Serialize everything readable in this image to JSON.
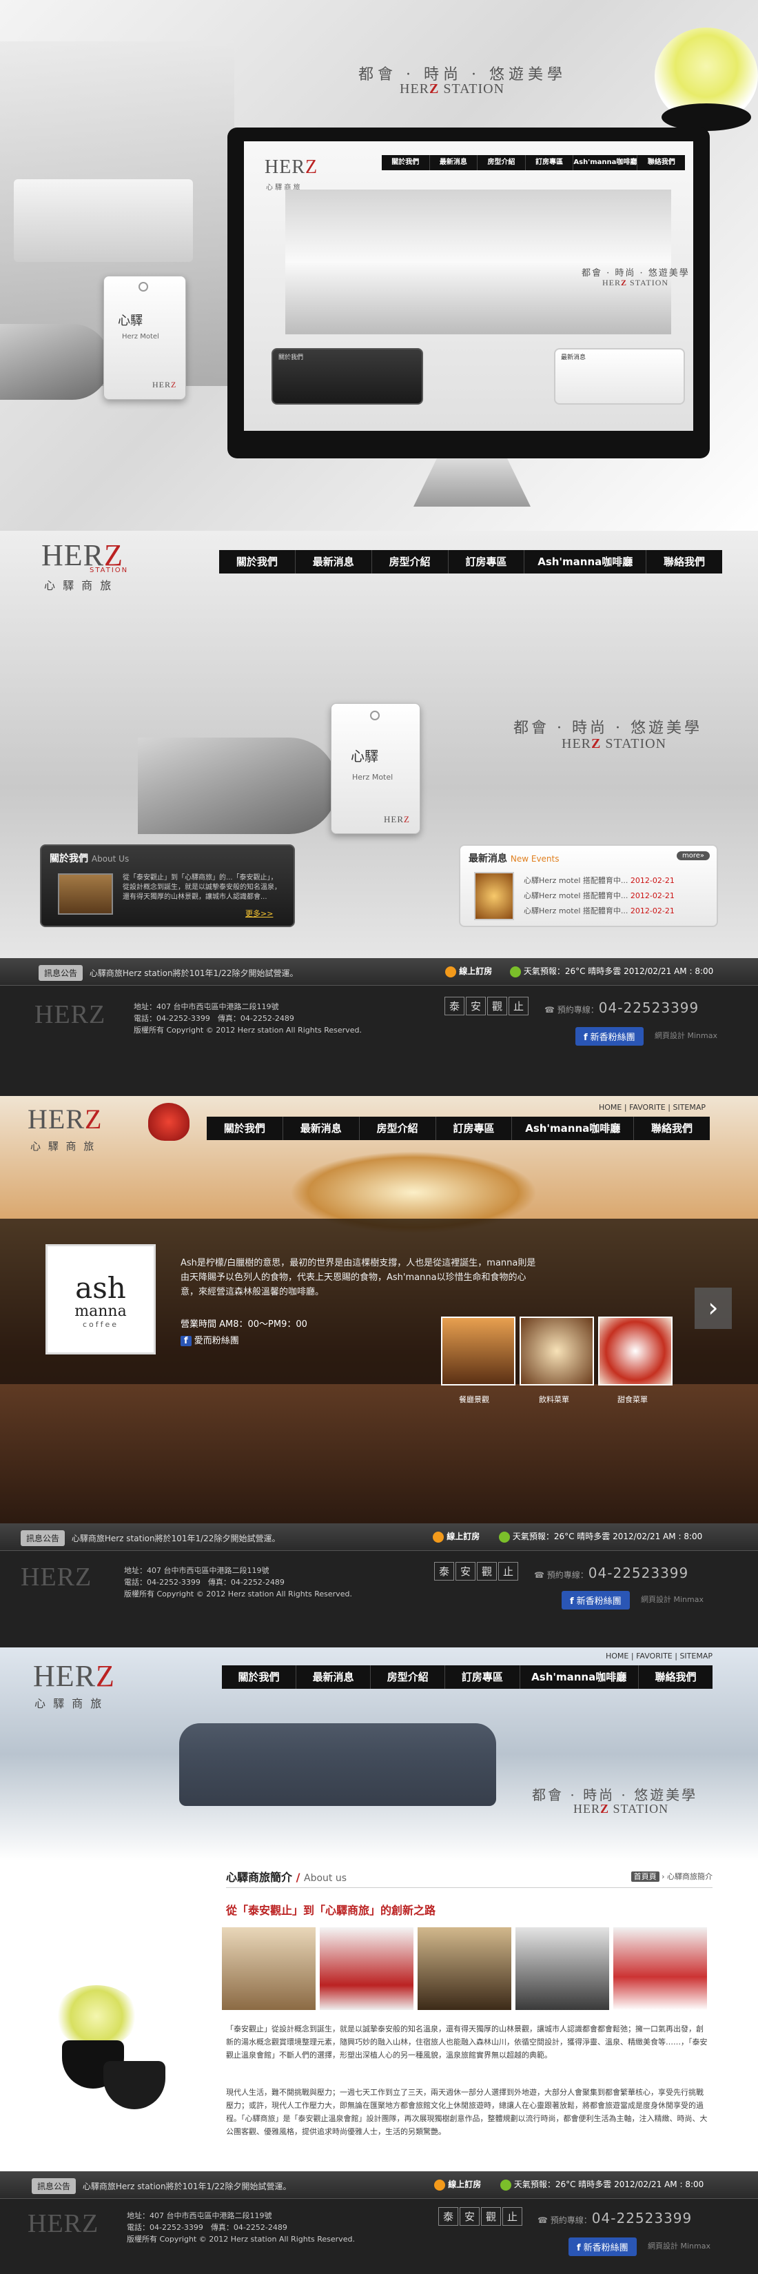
{
  "tagline": {
    "cn": "都會 · 時尚 · 悠遊美學",
    "en_prefix": "HER",
    "en_z": "Z",
    "en_suffix": " STATION"
  },
  "logo": {
    "h": "HER",
    "z": "Z",
    "station": "STATION",
    "cn": "心 驛 商 旅"
  },
  "card": {
    "cn": "心驛",
    "en": "Herz Motel"
  },
  "nav": [
    "關於我們",
    "最新消息",
    "房型介紹",
    "訂房專區",
    "Ash'manna咖啡廳",
    "聯絡我們"
  ],
  "top_links": [
    "HOME",
    "FAVORITE",
    "SITEMAP"
  ],
  "about": {
    "title_cn": "關於我們",
    "title_en": "About Us",
    "text": "從「泰安觀止」到「心驛商旅」的...「泰安觀止」，從設計概念到誕生，就是以誠摯泰安般的知名溫泉，還有得天獨厚的山林景觀，讓城市人認識都會...",
    "more": "更多>>"
  },
  "news": {
    "title_cn": "最新消息",
    "title_en": "New Events",
    "more_btn": "more»",
    "items": [
      {
        "text": "心驛Herz motel 搭配體育中...",
        "date": "2012-02-21"
      },
      {
        "text": "心驛Herz motel 搭配體育中...",
        "date": "2012-02-21"
      },
      {
        "text": "心驛Herz motel 搭配體育中...",
        "date": "2012-02-21"
      }
    ]
  },
  "footer": {
    "notice_label": "訊息公告",
    "notice_text": "心驛商旅Herz station將於101年1/22除夕開始試營運。",
    "online_booking": "線上訂房",
    "weather": "天氣預報：26°C 晴時多雲 2012/02/21 AM : 8:00",
    "address": "地址：407 台中市西屯區中港路二段119號",
    "phone": "電話：04-2252-3399　傳真：04-2252-2489",
    "copyright": "版權所有 Copyright © 2012 Herz station All Rights Reserved.",
    "brand_chars": [
      "泰",
      "安",
      "觀",
      "止"
    ],
    "booking_label": "預約專線：",
    "booking_phone": "04-22523399",
    "fb_btn": "新香粉絲團",
    "design": "網頁設計 Minmax"
  },
  "cafe": {
    "logo_ash": "ash",
    "logo_manna": "manna",
    "logo_coffee": "coffee",
    "desc": "Ash是柠檬/白臘樹的意思，最初的世界是由這棵樹支撐，人也是從這裡誕生，manna則是由天降賜予以色列人的食物，代表上天恩賜的食物，Ash'manna以珍惜生命和食物的心意，來經營這森林般溫馨的咖啡廳。",
    "hours": "營業時間 AM8：00～PM9：00",
    "fb": "愛而粉絲團",
    "thumbs": [
      "餐廳景觀",
      "飲料菜單",
      "甜食菜單"
    ]
  },
  "about_page": {
    "title_cn": "心驛商旅簡介",
    "title_en": "About us",
    "crumb_home": "首頁頁",
    "crumb_current": "心驛商旅簡介",
    "headline": "從「泰安觀止」到「心驛商旅」的創新之路",
    "para1": "「泰安觀止」從設計概念到誕生，就是以誠摯泰安般的知名溫泉，還有得天獨厚的山林景觀，讓城市人認識都會都會鬆弛；擁一口氣再出發，創新的湯水概念觀賞環境整理元素，隨興巧妙的融入山林，住宿旅人也能融入森林山川，依循空間設計，獲得淨靈、溫泉、精緻美食等……，「泰安觀止溫泉會館」不斷人們的選擇，形塑出深植人心的另一種風貌，溫泉旅館實界無以超越的典範。",
    "para2": "現代人生活，難不開挑戰與壓力；一週七天工作到立了三天，兩天週休一部分人選擇到外地遊，大部分人會聚集到都會繁華核心，享受先行挑戰壓力；或許，現代人工作壓力大，即無論在匯聚地方都會旅館文化上休閒旅遊時，總讓人在心靈跟著放鬆，將都會旅遊當成是度身休閒享受的過程。「心驛商旅」是「泰安觀止溫泉會館」設計團隊，再次展現獨樹創意作品，整體規劃以流行時尚，都會便利生活為主軸，注入精緻、時尚、大公團客觀、優雅風格，提供追求時尚優雅人士，生活的另類驚艷。"
  }
}
